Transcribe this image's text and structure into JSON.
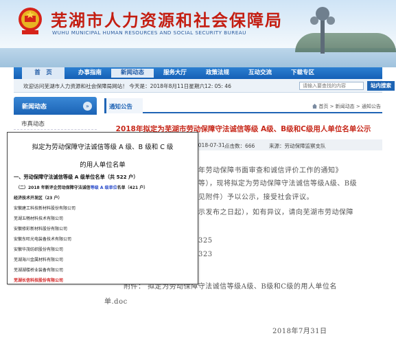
{
  "header": {
    "title": "芜湖市人力资源和社会保障局",
    "subtitle": "WUHU MUNICIPAL HUMAN RESOURCES AND SOCIAL SECURITY BUREAU"
  },
  "nav": {
    "items": [
      "首　页",
      "办事指南",
      "新闻动态",
      "服务大厅",
      "政策法规",
      "互动交流",
      "下载专区"
    ],
    "active_index": 2
  },
  "infobar": {
    "welcome": "欢迎访问芜湖市人力资源和社会保障局网站！ 今天是：2018年8月11日星期六12: 05: 46",
    "search_placeholder": "请输入要查找的内容",
    "search_button": "站内搜索"
  },
  "sidebar": {
    "title": "新闻动态",
    "items": [
      "市真动态"
    ]
  },
  "main": {
    "tab": "通知公告",
    "breadcrumb": "首页 > 新闻动态 > 通知公告",
    "article_title": "2018年拟定为芜湖市劳动保障守法诚信等级 A级、B级和C级用人单位名单公示",
    "meta_date": "2018-07-31",
    "meta_clicks": "点击数：666",
    "meta_source": "来源：劳动保障监察支队",
    "body_lines": [
      "年劳动保障书面审查和诚信评价工作的通知》",
      "等），现将拟定为劳动保障守法诚信等级A级、B级",
      "见附件）予以公示，接受社会评议。",
      "示发布之日起），如有异议，请向芜湖市劳动保障",
      "325",
      "323",
      "附件：  拟定为劳动保障守法诚信等级A级、B级和C级的用人单位名",
      "单.doc",
      "2018年7月31日"
    ]
  },
  "popup": {
    "title1": "拟定为劳动保障守法诚信等级 A 级、B 级和 C 级",
    "title2": "的用人单位名单",
    "section": "一、劳动保障守法诚信等级 A 级单位名单（共 522 户）",
    "sub_prefix": "（二）2018 年新评企劳动保障守法诚信",
    "sub_highlight": "等级 A 级单位",
    "sub_suffix": "名单（421 户）",
    "category": "经济技术开发区（23 户）",
    "companies": [
      "安徽建工科技新材料股份有限公司",
      "芜湖五畅材料技术有限公司",
      "安徽修彩新材料股份有限公司",
      "安徽东旺光电装备技术有限公司",
      "安徽华茂纺织股份有限公司",
      "芜湖海川金属材料有限公司",
      "芜湖湖楼桥业装备有限公司",
      "芜湖长信科技股份有限公司"
    ],
    "last_company_color": "#d21e1e"
  }
}
